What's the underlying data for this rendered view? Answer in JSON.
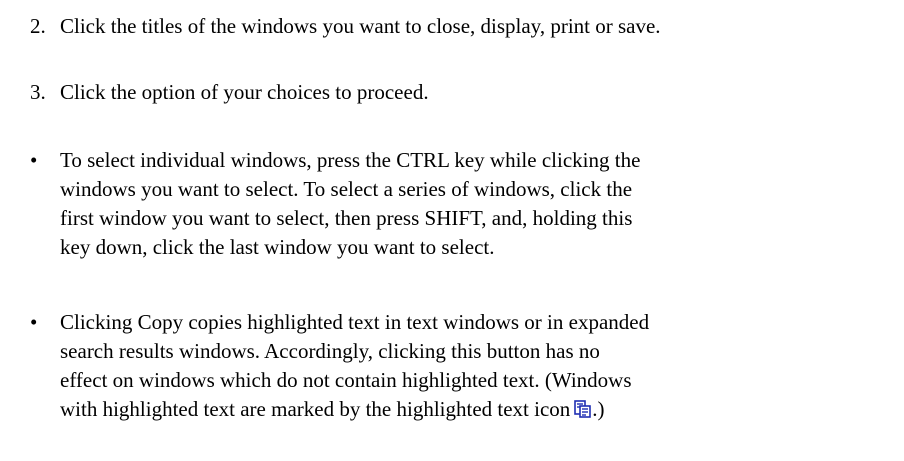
{
  "steps": [
    {
      "number": "2.",
      "text": "Click the titles of the windows you want to close, display, print or save."
    },
    {
      "number": "3.",
      "text": "Click the option of your choices to proceed."
    }
  ],
  "bullet_glyph": "•",
  "bullets": [
    {
      "lines": [
        "To select individual windows, press the CTRL key while clicking the",
        "windows you want to select. To select a series of windows, click the",
        "first window you want to select, then press SHIFT, and, holding this",
        "key down, click the last window you want to select."
      ]
    },
    {
      "lines": [
        "Clicking Copy copies highlighted text in text windows or in expanded",
        "search results windows. Accordingly, clicking this button has no",
        "effect on windows which do not contain highlighted text. (Windows",
        "with highlighted text are marked by the highlighted text icon"
      ],
      "closing": ".)"
    }
  ],
  "icons": {
    "highlighted_text": "highlighted-text-icon"
  },
  "colors": {
    "text": "#000000",
    "icon_blue": "#1f2fb3"
  }
}
